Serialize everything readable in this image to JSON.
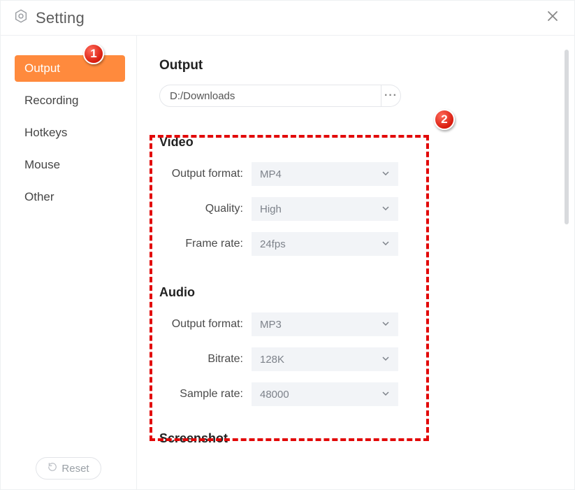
{
  "window_title": "Setting",
  "sidebar": {
    "items": [
      {
        "label": "Output",
        "active": true
      },
      {
        "label": "Recording",
        "active": false
      },
      {
        "label": "Hotkeys",
        "active": false
      },
      {
        "label": "Mouse",
        "active": false
      },
      {
        "label": "Other",
        "active": false
      }
    ],
    "reset_label": "Reset"
  },
  "output": {
    "section_title": "Output",
    "path_value": "D:/Downloads",
    "video": {
      "title": "Video",
      "format_label": "Output format:",
      "format_value": "MP4",
      "quality_label": "Quality:",
      "quality_value": "High",
      "framerate_label": "Frame rate:",
      "framerate_value": "24fps"
    },
    "audio": {
      "title": "Audio",
      "format_label": "Output format:",
      "format_value": "MP3",
      "bitrate_label": "Bitrate:",
      "bitrate_value": "128K",
      "samplerate_label": "Sample rate:",
      "samplerate_value": "48000"
    },
    "screenshot_title": "Screenshot"
  },
  "annotations": {
    "callout1": "1",
    "callout2": "2"
  }
}
